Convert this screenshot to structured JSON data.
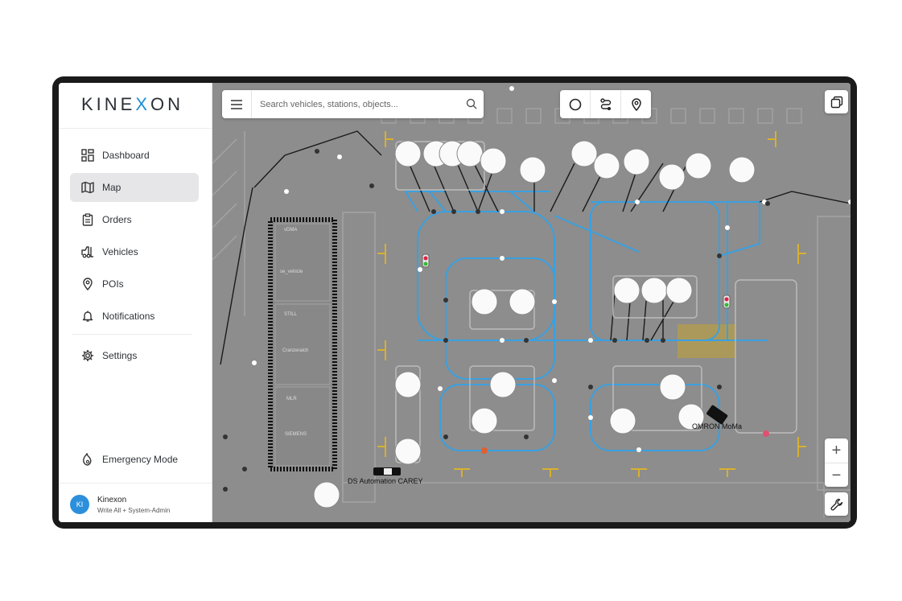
{
  "app": {
    "logo": "KINEXON"
  },
  "sidebar": {
    "items": [
      {
        "label": "Dashboard",
        "icon": "dashboard-icon"
      },
      {
        "label": "Map",
        "icon": "map-icon",
        "active": true
      },
      {
        "label": "Orders",
        "icon": "clipboard-icon"
      },
      {
        "label": "Vehicles",
        "icon": "forklift-icon"
      },
      {
        "label": "POIs",
        "icon": "location-pin-icon"
      },
      {
        "label": "Notifications",
        "icon": "bell-icon"
      },
      {
        "label": "Settings",
        "icon": "gear-icon"
      }
    ],
    "emergency": {
      "label": "Emergency Mode",
      "icon": "emergency-icon"
    },
    "user": {
      "initials": "KI",
      "name": "Kinexon",
      "role": "Write All + System-Admin"
    }
  },
  "search": {
    "placeholder": "Search vehicles, stations, objects..."
  },
  "toolbar": {
    "tools": [
      "circle-icon",
      "route-icon",
      "location-pin-icon"
    ]
  },
  "zoom": {
    "in": "+",
    "out": "−"
  },
  "map": {
    "vehicle_labels": [
      "DS Automation CAREY",
      "OMRON MoMa"
    ],
    "rack_labels": [
      "vDMA",
      "se_vehicle",
      "STILL",
      "Cranzeraich",
      "MLR",
      "SIEMENS"
    ]
  },
  "colors": {
    "accent": "#1d8fd6",
    "path": "#3aa0e0",
    "map_bg": "#8d8d8d",
    "zone": "#bfa23b"
  }
}
